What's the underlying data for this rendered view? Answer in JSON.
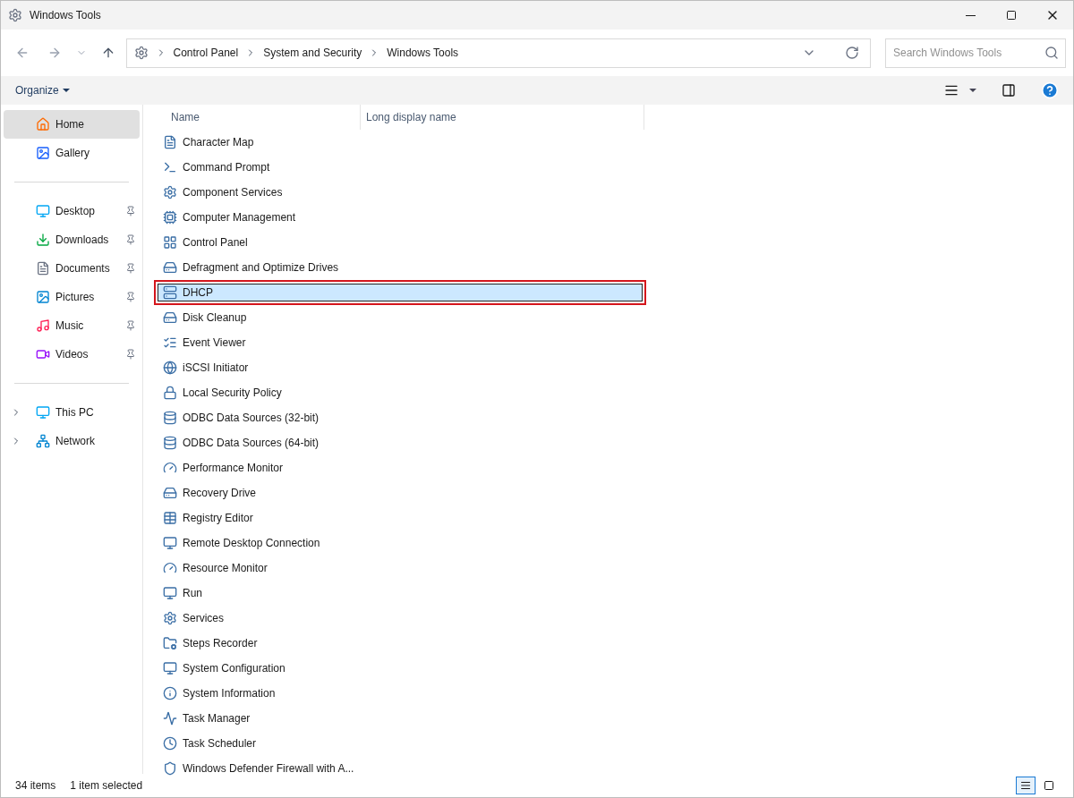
{
  "window": {
    "title": "Windows Tools"
  },
  "address_bar": {
    "crumbs": [
      "Control Panel",
      "System and Security",
      "Windows Tools"
    ]
  },
  "search": {
    "placeholder": "Search Windows Tools"
  },
  "command_bar": {
    "organize": "Organize"
  },
  "sidebar": {
    "groups": [
      [
        {
          "label": "Home",
          "selected": true,
          "pinned": false
        },
        {
          "label": "Gallery",
          "selected": false,
          "pinned": false
        }
      ],
      [
        {
          "label": "Desktop",
          "selected": false,
          "pinned": true
        },
        {
          "label": "Downloads",
          "selected": false,
          "pinned": true
        },
        {
          "label": "Documents",
          "selected": false,
          "pinned": true
        },
        {
          "label": "Pictures",
          "selected": false,
          "pinned": true
        },
        {
          "label": "Music",
          "selected": false,
          "pinned": true
        },
        {
          "label": "Videos",
          "selected": false,
          "pinned": true
        }
      ],
      [
        {
          "label": "This PC",
          "selected": false,
          "expanded": false
        },
        {
          "label": "Network",
          "selected": false,
          "expanded": false
        }
      ]
    ]
  },
  "table": {
    "columns": [
      "Name",
      "Long display name"
    ],
    "rows": [
      {
        "name": "Character Map",
        "selected": false
      },
      {
        "name": "Command Prompt",
        "selected": false
      },
      {
        "name": "Component Services",
        "selected": false
      },
      {
        "name": "Computer Management",
        "selected": false
      },
      {
        "name": "Control Panel",
        "selected": false
      },
      {
        "name": "Defragment and Optimize Drives",
        "selected": false
      },
      {
        "name": "DHCP",
        "selected": true
      },
      {
        "name": "Disk Cleanup",
        "selected": false
      },
      {
        "name": "Event Viewer",
        "selected": false
      },
      {
        "name": "iSCSI Initiator",
        "selected": false
      },
      {
        "name": "Local Security Policy",
        "selected": false
      },
      {
        "name": "ODBC Data Sources (32-bit)",
        "selected": false
      },
      {
        "name": "ODBC Data Sources (64-bit)",
        "selected": false
      },
      {
        "name": "Performance Monitor",
        "selected": false
      },
      {
        "name": "Recovery Drive",
        "selected": false
      },
      {
        "name": "Registry Editor",
        "selected": false
      },
      {
        "name": "Remote Desktop Connection",
        "selected": false
      },
      {
        "name": "Resource Monitor",
        "selected": false
      },
      {
        "name": "Run",
        "selected": false
      },
      {
        "name": "Services",
        "selected": false
      },
      {
        "name": "Steps Recorder",
        "selected": false
      },
      {
        "name": "System Configuration",
        "selected": false
      },
      {
        "name": "System Information",
        "selected": false
      },
      {
        "name": "Task Manager",
        "selected": false
      },
      {
        "name": "Task Scheduler",
        "selected": false
      },
      {
        "name": "Windows Defender Firewall with A...",
        "selected": false
      }
    ]
  },
  "status_bar": {
    "count": "34 items",
    "selection": "1 item selected",
    "views": [
      {
        "kind": "details",
        "selected": true
      },
      {
        "kind": "tiles",
        "selected": false
      }
    ]
  }
}
